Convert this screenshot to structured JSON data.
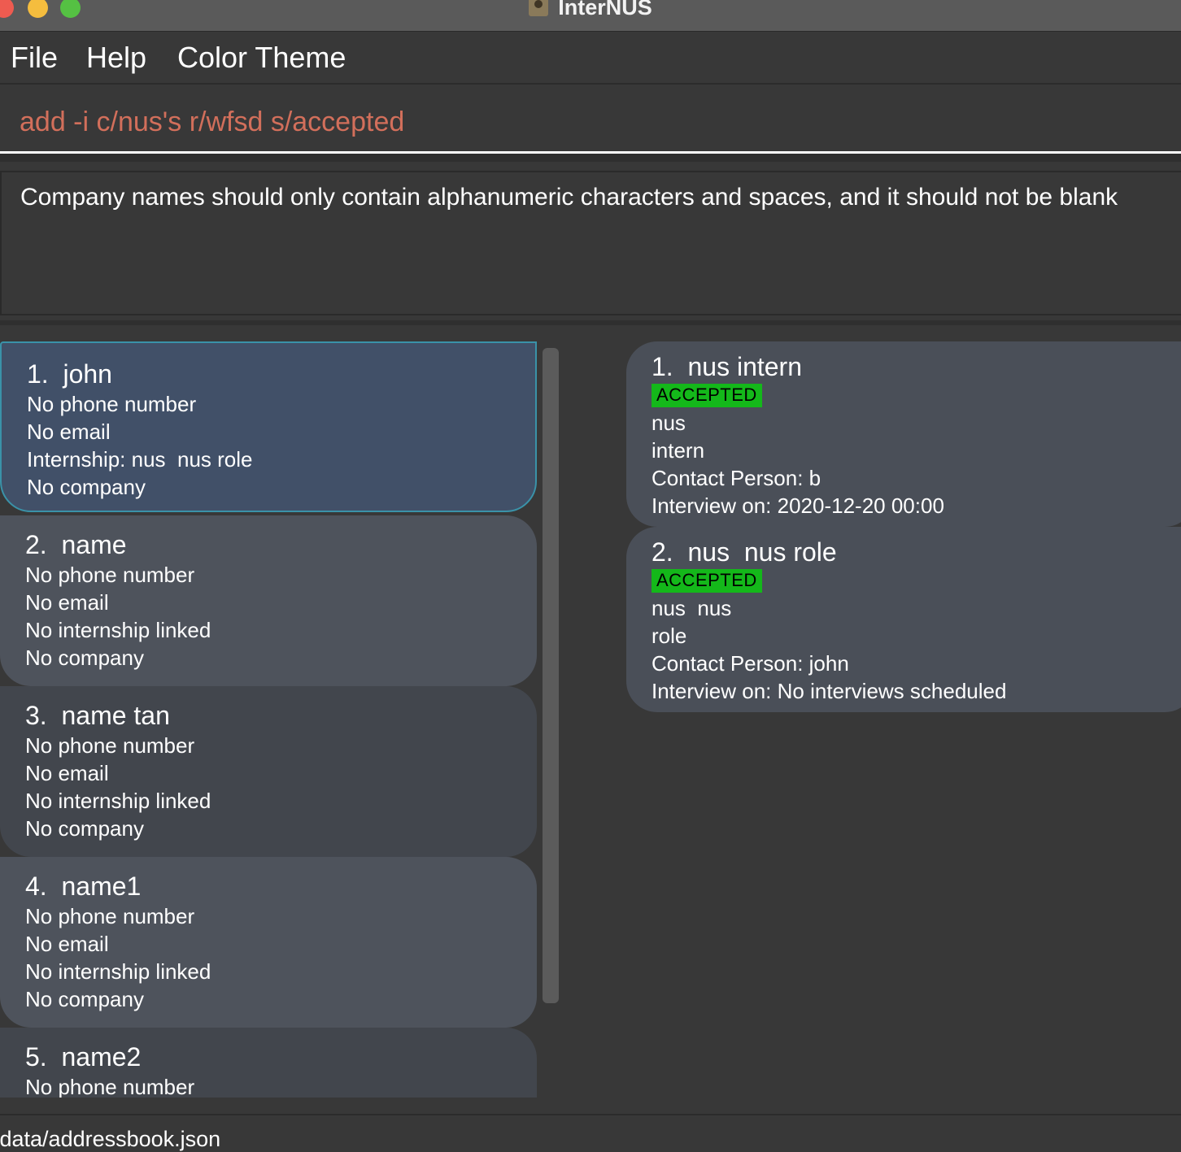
{
  "window": {
    "title": "InterNUS",
    "controls": {
      "close_color": "#ee5b50",
      "minimize_color": "#f5bd3e",
      "zoom_color": "#55c143"
    }
  },
  "menu": {
    "items": [
      {
        "label": "File"
      },
      {
        "label": "Help"
      },
      {
        "label": "Color Theme"
      }
    ]
  },
  "command": {
    "value": "add -i c/nus's r/wfsd s/accepted",
    "text_color": "#d26f5b"
  },
  "result": {
    "message": "Company names should only contain alphanumeric characters and spaces, and it should not be blank"
  },
  "persons": [
    {
      "index": "1.",
      "name": "john",
      "phone": "No phone number",
      "email": "No email",
      "internship": "Internship: nus  nus role",
      "company": "No company",
      "selected": true
    },
    {
      "index": "2.",
      "name": "name",
      "phone": "No phone number",
      "email": "No email",
      "internship": "No internship linked",
      "company": "No company"
    },
    {
      "index": "3.",
      "name": "name tan",
      "phone": "No phone number",
      "email": "No email",
      "internship": "No internship linked",
      "company": "No company"
    },
    {
      "index": "4.",
      "name": "name1",
      "phone": "No phone number",
      "email": "No email",
      "internship": "No internship linked",
      "company": "No company"
    },
    {
      "index": "5.",
      "name": "name2",
      "phone": "No phone number"
    }
  ],
  "internships": [
    {
      "index": "1.",
      "title": "nus intern",
      "status": "ACCEPTED",
      "company": "nus",
      "role": "intern",
      "contact": "Contact Person: b",
      "interview": "Interview on: 2020-12-20 00:00"
    },
    {
      "index": "2.",
      "title": "nus  nus role",
      "status": "ACCEPTED",
      "company": "nus  nus",
      "role": "role",
      "contact": "Contact Person: john",
      "interview": "Interview on: No interviews scheduled"
    }
  ],
  "status_bar": {
    "path": "/data/addressbook.json"
  },
  "colors": {
    "background": "#383838",
    "card_selected": "#415068",
    "card_selected_border": "#3a92a8",
    "badge_accepted": "#14b81a"
  }
}
